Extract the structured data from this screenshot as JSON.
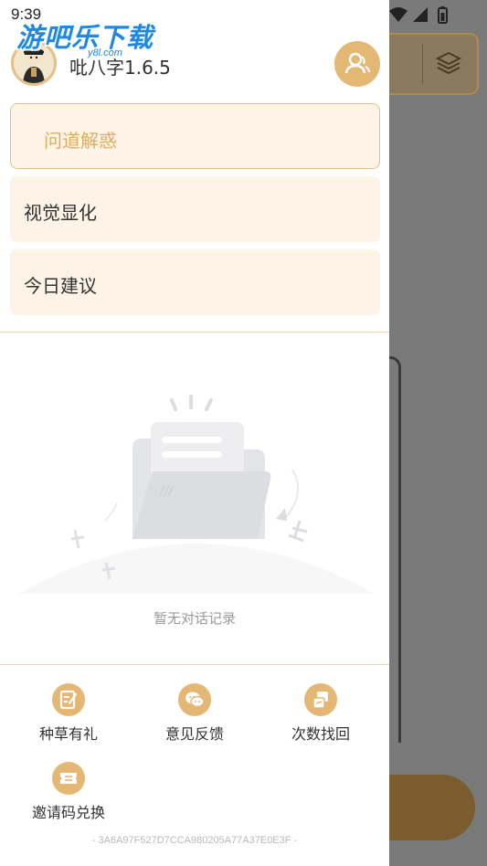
{
  "status_bar": {
    "time": "9:39"
  },
  "watermark": {
    "title": "游吧乐下载",
    "subtitle": "y8l.com"
  },
  "header": {
    "app_name": "吡八字1.6.5"
  },
  "menu": [
    {
      "label": "问道解惑",
      "active": true
    },
    {
      "label": "视觉显化",
      "active": false
    },
    {
      "label": "今日建议",
      "active": false
    }
  ],
  "empty_state": {
    "text": "暂无对话记录"
  },
  "quick_actions": [
    {
      "label": "种草有礼",
      "icon": "edit-note-icon"
    },
    {
      "label": "意见反馈",
      "icon": "chat-bubble-icon"
    },
    {
      "label": "次数找回",
      "icon": "refresh-icon"
    },
    {
      "label": "邀请码兑换",
      "icon": "ticket-icon"
    }
  ],
  "device_id": "- 3A6A97F527D7CCA980205A77A37E0E3F -",
  "colors": {
    "accent": "#e5b774",
    "menu_bg": "#fdf3e7",
    "active_text": "#e0ad5e"
  }
}
